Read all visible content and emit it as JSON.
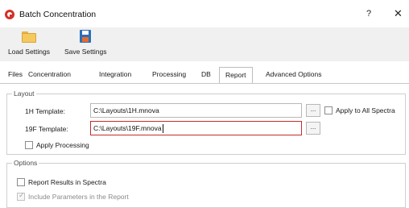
{
  "window": {
    "title": "Batch Concentration",
    "help_label": "?",
    "close_label": "✕",
    "app_icon": "mnova-logo-icon"
  },
  "toolbar": {
    "load_settings": {
      "label": "Load Settings",
      "icon": "folder-icon"
    },
    "save_settings": {
      "label": "Save Settings",
      "icon": "floppy-disk-icon"
    }
  },
  "tabs": [
    "Files",
    "Concentration",
    "Integration",
    "Processing",
    "DB",
    "Report",
    "Advanced Options"
  ],
  "active_tab": "Report",
  "layout_group": {
    "legend": "Layout",
    "h1_template": {
      "label": "1H Template:",
      "value": "C:\\Layouts\\1H.mnova",
      "browse_label": "..."
    },
    "f19_template": {
      "label": "19F Template:",
      "value": "C:\\Layouts\\19F.mnova",
      "browse_label": "..."
    },
    "apply_to_all": {
      "label": "Apply to All Spectra",
      "checked": false
    },
    "apply_processing": {
      "label": "Apply Processing",
      "checked": false
    }
  },
  "options_group": {
    "legend": "Options",
    "report_results": {
      "label": "Report Results in Spectra",
      "checked": false
    },
    "include_parameters": {
      "label": "Include Parameters in the Report",
      "checked": true,
      "enabled": false
    }
  },
  "colors": {
    "focus_border": "#c72c2c",
    "toolbar_bg": "#f0f0f0",
    "app_icon_red": "#d4302a"
  }
}
